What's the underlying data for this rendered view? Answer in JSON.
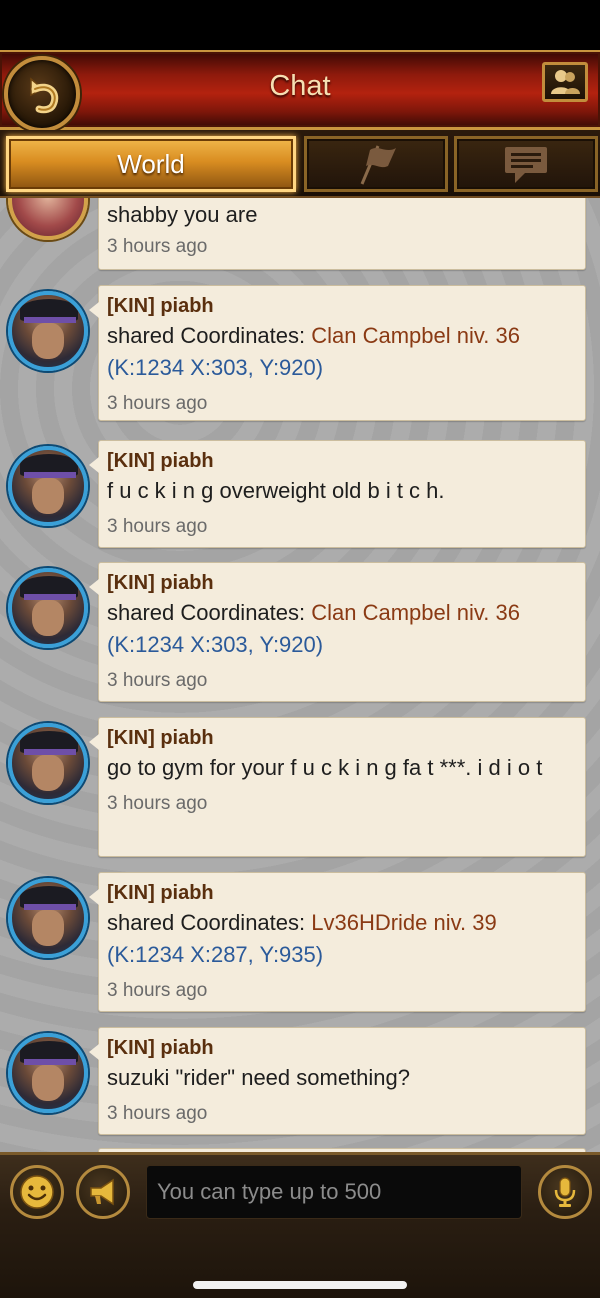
{
  "header": {
    "title": "Chat"
  },
  "tabs": [
    {
      "label": "World",
      "active": true,
      "icon": "world"
    },
    {
      "label": "",
      "active": false,
      "icon": "clan-flag-icon"
    },
    {
      "label": "",
      "active": false,
      "icon": "private-message-icon"
    }
  ],
  "messages": [
    {
      "avatar": "female-avatar",
      "sender": "",
      "text": "shabby you are",
      "coord_name": "",
      "coord": "",
      "time": "3 hours ago"
    },
    {
      "avatar": "piabh-avatar",
      "sender": "[KIN] piabh",
      "text": "shared Coordinates: ",
      "coord_name": "Clan Campbel niv. 36",
      "coord": "(K:1234 X:303, Y:920)",
      "time": "3 hours ago"
    },
    {
      "avatar": "piabh-avatar",
      "sender": "[KIN] piabh",
      "text": "f u c k i n g overweight old b i t c h.",
      "coord_name": "",
      "coord": "",
      "time": "3 hours ago"
    },
    {
      "avatar": "piabh-avatar",
      "sender": "[KIN] piabh",
      "text": "shared Coordinates: ",
      "coord_name": "Clan Campbel niv. 36",
      "coord": "(K:1234 X:303, Y:920)",
      "time": "3 hours ago"
    },
    {
      "avatar": "piabh-avatar",
      "sender": "[KIN] piabh",
      "text": "go to gym for your f u c k i n g fa t ***. i d i o t",
      "coord_name": "",
      "coord": "",
      "time": "3 hours ago"
    },
    {
      "avatar": "piabh-avatar",
      "sender": "[KIN] piabh",
      "text": "shared Coordinates: ",
      "coord_name": "Lv36HDride niv. 39",
      "coord": "(K:1234 X:287, Y:935)",
      "time": "3 hours ago"
    },
    {
      "avatar": "piabh-avatar",
      "sender": "[KIN] piabh",
      "text": "suzuki \"rider\" need something?",
      "coord_name": "",
      "coord": "",
      "time": "3 hours ago"
    }
  ],
  "input": {
    "placeholder": "You can type up to 500"
  },
  "colors": {
    "header_red": "#b3220f",
    "gold": "#c9953f",
    "tab_active": "#d98d21",
    "bubble": "#f4ecdc",
    "sender": "#5a2f0e",
    "coord_name": "#8a3a14",
    "coord": "#2b5a9a"
  }
}
